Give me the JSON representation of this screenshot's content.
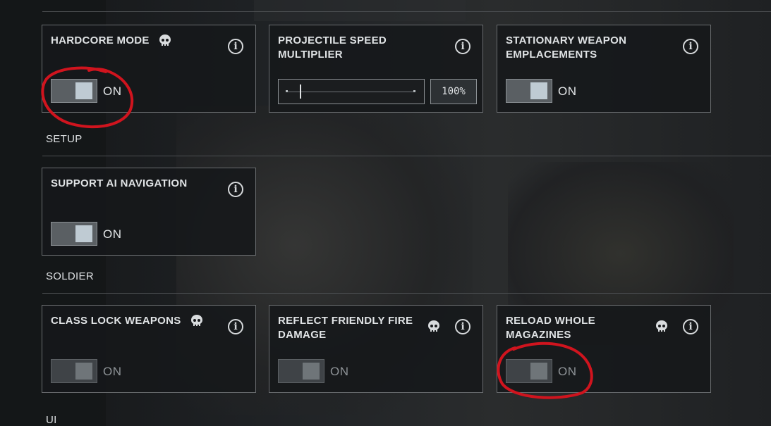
{
  "sections": {
    "setup": "SETUP",
    "soldier": "SOLDIER",
    "ui": "UI"
  },
  "cards": {
    "hardcore_mode": {
      "title": "HARDCORE MODE",
      "value": "ON",
      "enabled": true
    },
    "projectile_speed": {
      "title_line1": "PROJECTILE SPEED",
      "title_line2": "MULTIPLIER",
      "value": "100%",
      "slider_fraction": 0.1
    },
    "stationary_weapon": {
      "title_line1": "STATIONARY WEAPON",
      "title_line2": "EMPLACEMENTS",
      "value": "ON",
      "enabled": true
    },
    "support_ai_navigation": {
      "title": "SUPPORT AI NAVIGATION",
      "value": "ON",
      "enabled": true
    },
    "class_lock_weapons": {
      "title": "CLASS LOCK WEAPONS",
      "value": "ON",
      "enabled": false
    },
    "reflect_friendly_fire": {
      "title_line1": "REFLECT FRIENDLY FIRE",
      "title_line2": "DAMAGE",
      "value": "ON",
      "enabled": false
    },
    "reload_whole_magazines": {
      "title_line1": "RELOAD WHOLE",
      "title_line2": "MAGAZINES",
      "value": "ON",
      "enabled": false
    }
  },
  "icons": {
    "info": "info-icon",
    "hardcore": "skull-icon"
  },
  "colors": {
    "annotation": "#d0141e",
    "toggle_knob": "#bfcbd3",
    "border": "#6a6d70"
  }
}
